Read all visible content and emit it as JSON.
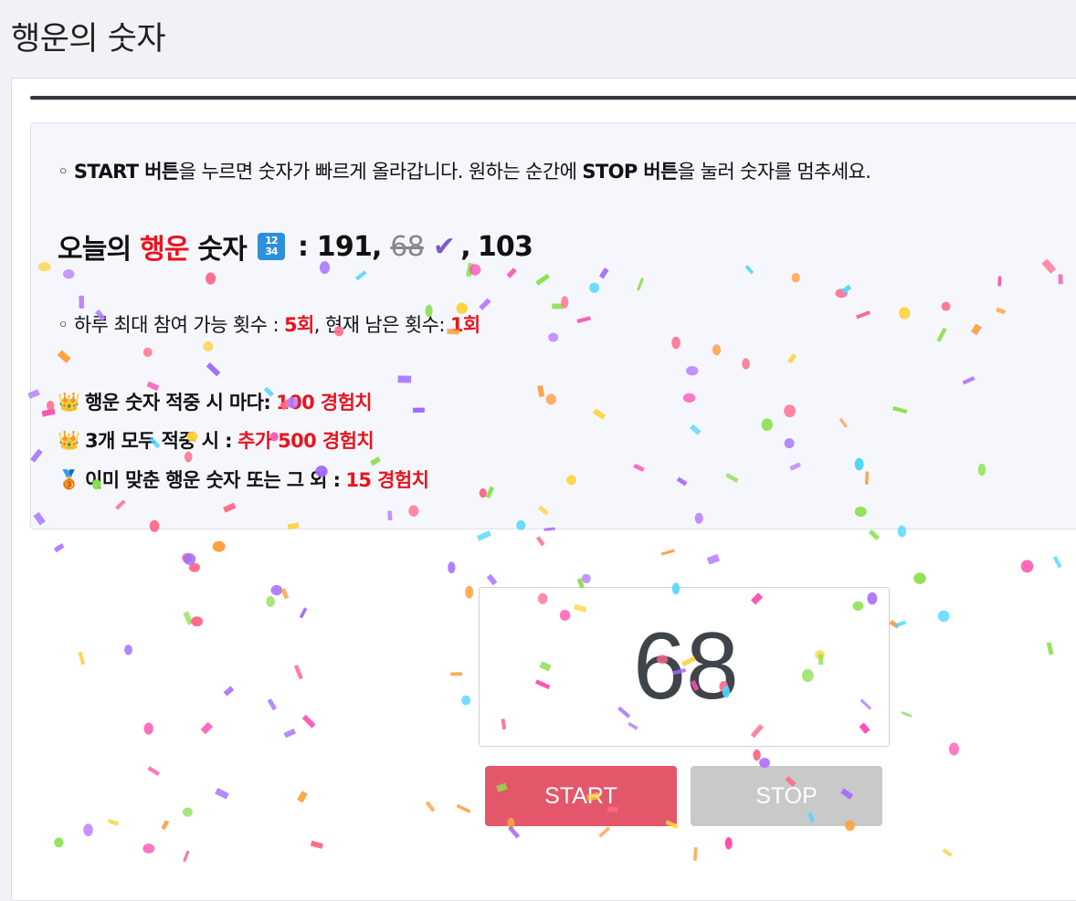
{
  "page": {
    "title": "행운의 숫자"
  },
  "intro": {
    "bullet": "◦",
    "start_label": "START 버튼",
    "text1": "을 누르면 숫자가 빠르게 올라갑니다. 원하는 순간에 ",
    "stop_label": "STOP 버튼",
    "text2": "을 눌러 숫자를 멈추세요."
  },
  "lucky": {
    "prefix": "오늘의",
    "highlight": "행운",
    "suffix": "숫자",
    "icon_lines": [
      "12",
      "34"
    ],
    "colon": ":",
    "numbers": [
      "191",
      "68",
      "103"
    ],
    "hit_index": 1,
    "check_icon": "✔"
  },
  "quota": {
    "bullet": "◦",
    "label": "하루 최대 참여 가능 횟수 : ",
    "max": "5회",
    "sep": ", 현재 남은 횟수: ",
    "remaining": "1회"
  },
  "rewards": [
    {
      "icon": "crown",
      "emoji": "👑",
      "label": "행운 숫자 적중 시 마다:",
      "value": "100 경험치"
    },
    {
      "icon": "crown-heart",
      "emoji": "👑",
      "label": "3개 모두 적중 시 :",
      "value": "추가 500 경험치"
    },
    {
      "icon": "bronze-medal",
      "emoji": "🥉",
      "label": "이미 맞춘 행운 숫자 또는 그 외 :",
      "value": "15 경험치"
    }
  ],
  "counter": {
    "value": "68"
  },
  "buttons": {
    "start": "START",
    "stop": "STOP"
  },
  "colors": {
    "accent_red": "#e8141e",
    "start_button": "#e4576b",
    "stop_button": "#c9c9c9",
    "check": "#7e5bc8",
    "confetti": [
      "#ff6b8b",
      "#ffd23f",
      "#a06bff",
      "#4cd6ff",
      "#8be04e",
      "#ff9f40",
      "#ff4fb0",
      "#b57bff"
    ]
  }
}
